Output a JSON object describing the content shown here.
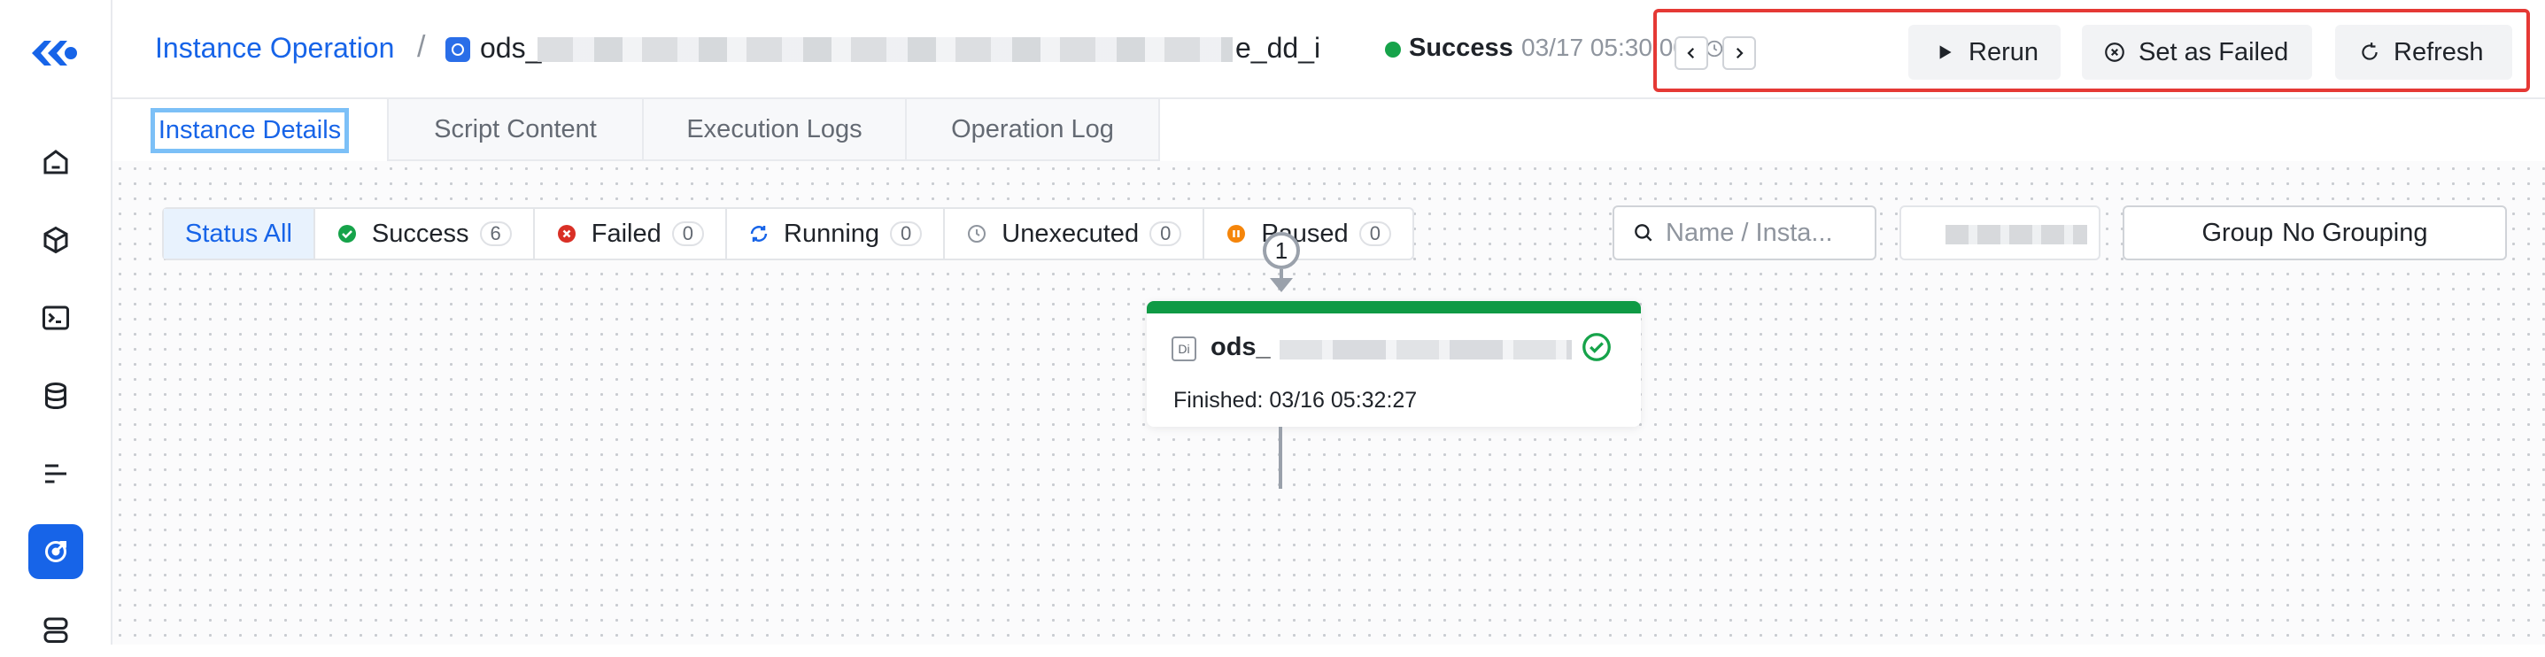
{
  "header": {
    "breadcrumb": "Instance Operation",
    "separator": "/",
    "task_prefix": "ods_",
    "task_suffix": "e_dd_i",
    "status": "Success",
    "status_time": "03/17 05:30:00",
    "status_color": "#16a34a"
  },
  "toolbar": {
    "prev_icon": "chevron-left-icon",
    "next_icon": "chevron-right-icon",
    "rerun_label": "Rerun",
    "set_failed_label": "Set as Failed",
    "refresh_label": "Refresh"
  },
  "tabs": [
    {
      "label": "Instance Details"
    },
    {
      "label": "Script Content"
    },
    {
      "label": "Execution Logs"
    },
    {
      "label": "Operation Log"
    }
  ],
  "filters": {
    "status_all": "Status All",
    "items": [
      {
        "label": "Success",
        "count": "6",
        "color": "#16a34a"
      },
      {
        "label": "Failed",
        "count": "0",
        "color": "#d93026"
      },
      {
        "label": "Running",
        "count": "0",
        "color": "#1764e8"
      },
      {
        "label": "Unexecuted",
        "count": "0",
        "color": "#8f959e"
      },
      {
        "label": "Paused",
        "count": "0",
        "color": "#f5850a"
      }
    ],
    "search_placeholder": "Name / Insta...",
    "group_label": "Group",
    "group_value": "No Grouping"
  },
  "node": {
    "index": "1",
    "type_label": "Di",
    "name_prefix": "ods_",
    "finished": "Finished: 03/16 05:32:27",
    "status_color": "#0f9a45"
  },
  "colors": {
    "accent": "#1764e8",
    "highlight_border": "#e53935"
  }
}
